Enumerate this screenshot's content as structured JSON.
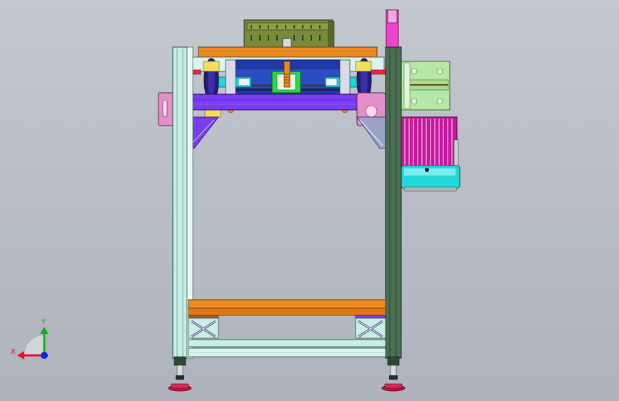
{
  "viewport": {
    "background_top": "#c4c8cf",
    "background_bottom": "#aeb3bc"
  },
  "model": {
    "colors": {
      "frame_light": "#c8efe6",
      "frame_dark": "#4c6e52",
      "beam_orange": "#ee8a22",
      "beam_purple": "#7a3cf0",
      "belt_blue": "#1f3aa8",
      "gearbox_olive": "#7a8a3a",
      "motor_magenta": "#c2189a",
      "motor_cyan": "#22d8d8",
      "bracket_pink": "#e490c8",
      "plate_green": "#b4e8a4",
      "foot_red": "#c41444",
      "cylinder_green": "#2ad84a",
      "tab_magenta": "#ee44cc"
    }
  },
  "triad": {
    "x_label": "X",
    "y_label": "Y",
    "x_color": "#e0102a",
    "y_color": "#10b01a",
    "z_color": "#1022e0"
  }
}
